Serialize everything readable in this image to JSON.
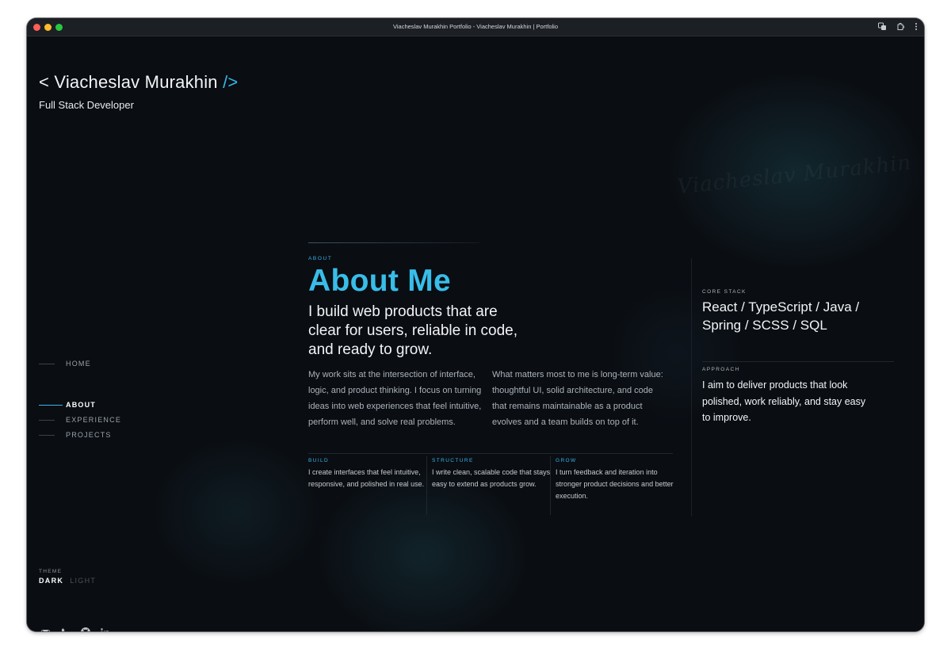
{
  "window": {
    "title": "Viacheslav Murakhin Portfolio - Viacheslav Murakhin | Portfolio"
  },
  "header": {
    "brand_prefix": "< Viacheslav Murakhin",
    "brand_suffix": "/>",
    "role": "Full Stack Developer"
  },
  "signature_text": "Viacheslav Murakhin",
  "nav": {
    "items": [
      {
        "label": "HOME",
        "active": false
      },
      {
        "label": "ABOUT",
        "active": true
      },
      {
        "label": "EXPERIENCE",
        "active": false
      },
      {
        "label": "PROJECTS",
        "active": false
      }
    ]
  },
  "theme": {
    "label": "THEME",
    "dark": "DARK",
    "light": "LIGHT",
    "selected": "DARK"
  },
  "social": {
    "icons": [
      "mail-icon",
      "phone-icon",
      "github-icon",
      "linkedin-icon"
    ]
  },
  "about": {
    "eyebrow": "ABOUT",
    "title": "About Me",
    "lead": "I build web products that are clear for users, reliable in code, and ready to grow.",
    "paragraph_left": "My work sits at the intersection of interface, logic, and product thinking. I focus on turning ideas into web experiences that feel intuitive, perform well, and solve real problems.",
    "paragraph_right": "What matters most to me is long-term value: thoughtful UI, solid architecture, and code that remains maintainable as a product evolves and a team builds on top of it.",
    "cards": [
      {
        "label": "BUILD",
        "text": "I create interfaces that feel intuitive, responsive, and polished in real use."
      },
      {
        "label": "STRUCTURE",
        "text": "I write clean, scalable code that stays easy to extend as products grow."
      },
      {
        "label": "GROW",
        "text": "I turn feedback and iteration into stronger product decisions and better execution."
      }
    ]
  },
  "aside": {
    "stack_label": "CORE STACK",
    "stack_text": "React / TypeScript / Java / Spring / SCSS / SQL",
    "approach_label": "APPROACH",
    "approach_text": "I aim to deliver products that look polished, work reliably, and stay easy to improve."
  },
  "colors": {
    "background": "#0a0d12",
    "accent": "#34b6e8",
    "text_primary": "#f2f4f6",
    "text_muted": "#aab3bb"
  }
}
